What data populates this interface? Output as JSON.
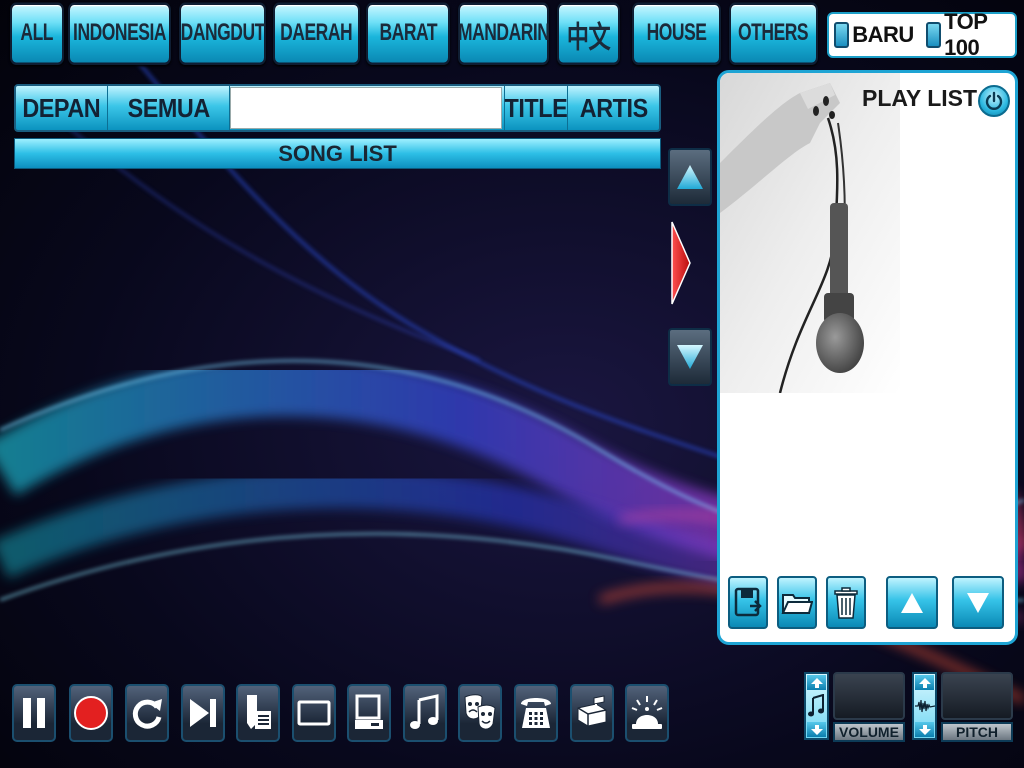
{
  "categories": [
    "ALL",
    "INDONESIA",
    "DANGDUT",
    "DAERAH",
    "BARAT",
    "MANDARIN",
    "中文",
    "HOUSE",
    "OTHERS"
  ],
  "filters": {
    "new_label": "BARU",
    "top_label": "TOP 100"
  },
  "search": {
    "front_label": "DEPAN",
    "all_label": "SEMUA",
    "query": "",
    "title_label": "TITLE",
    "artist_label": "ARTIS"
  },
  "song_list": {
    "header": "SONG LIST"
  },
  "playlist": {
    "title": "PLAY LIST"
  },
  "controls": {
    "volume_label": "VOLUME",
    "pitch_label": "PITCH"
  },
  "icons": {
    "transport": [
      "pause-icon",
      "record-icon",
      "repeat-icon",
      "skip-next-icon",
      "score-icon",
      "screen-icon",
      "computer-icon",
      "music-note-icon",
      "drama-masks-icon",
      "telephone-icon",
      "mailbox-icon",
      "service-bell-icon"
    ],
    "playlist": [
      "save-icon",
      "open-folder-icon",
      "trash-icon",
      "move-up-icon",
      "move-down-icon"
    ]
  },
  "colors": {
    "accent": "#1fb4dc",
    "record": "#e32020",
    "play_arrow": "#e01c1c"
  }
}
